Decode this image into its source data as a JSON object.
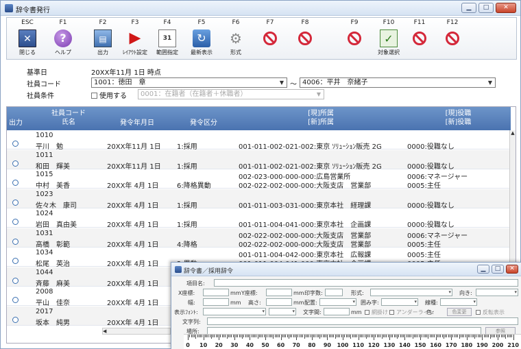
{
  "window": {
    "title": "辞令書発行"
  },
  "fkeys": [
    {
      "key": "ESC",
      "label": "閉じる",
      "icon": "close-icon"
    },
    {
      "key": "F1",
      "label": "ヘルプ",
      "icon": "help-icon"
    },
    {
      "key": "F2",
      "label": "出力",
      "icon": "output-icon"
    },
    {
      "key": "F3",
      "label": "ﾚｲｱｳﾄ設定",
      "icon": "play-icon"
    },
    {
      "key": "F4",
      "label": "範囲指定",
      "icon": "calendar-icon"
    },
    {
      "key": "F5",
      "label": "最新表示",
      "icon": "refresh-icon"
    },
    {
      "key": "F6",
      "label": "形式",
      "icon": "gear-icon"
    },
    {
      "key": "F7",
      "label": "",
      "icon": "disabled-icon"
    },
    {
      "key": "F8",
      "label": "",
      "icon": "disabled-icon"
    },
    {
      "key": "F9",
      "label": "",
      "icon": "disabled-icon"
    },
    {
      "key": "F10",
      "label": "対象選択",
      "icon": "check-icon"
    },
    {
      "key": "F11",
      "label": "",
      "icon": "disabled-icon"
    },
    {
      "key": "F12",
      "label": "",
      "icon": "disabled-icon"
    }
  ],
  "conditions": {
    "base_date_label": "基準日",
    "base_date_value": "20XX年11月 1日 時点",
    "emp_code_label": "社員コード",
    "emp_from": "1001：徳田　章",
    "tilde": "～",
    "emp_to": "4006：平井　奈緒子",
    "emp_cond_label": "社員条件",
    "use_label": "使用する",
    "cond_value": "0001：在籍者（在籍者＋休職者）"
  },
  "table": {
    "headers": {
      "out": "出力",
      "code": "社員コード",
      "name": "氏名",
      "issue_date": "発令年月日",
      "issue_type": "発令区分",
      "dept_cur": "[現]所属",
      "dept_new": "[新]所属",
      "pos_cur": "[現]役職",
      "pos_new": "[新]役職"
    },
    "rows": [
      {
        "code": "1010",
        "name": "平川　勉",
        "date": "20XX年11月 1日",
        "type": "1:採用",
        "dept1": "",
        "dept2": "001-011-002-021-002:東京 ｿﾘｭｰｼｮﾝ販売 2G",
        "pos1": "",
        "pos2": "0000:役職なし"
      },
      {
        "code": "1011",
        "name": "和田　輝美",
        "date": "20XX年11月 1日",
        "type": "1:採用",
        "dept1": "",
        "dept2": "001-011-002-021-002:東京 ｿﾘｭｰｼｮﾝ販売 2G",
        "pos1": "",
        "pos2": "0000:役職なし"
      },
      {
        "code": "1015",
        "name": "中村　美香",
        "date": "20XX年 4月 1日",
        "type": "6:降格異動",
        "dept1": "002-023-000-000-000:広島営業所",
        "dept2": "002-022-002-000-000:大阪支店　営業部",
        "pos1": "0006:マネージャー",
        "pos2": "0005:主任"
      },
      {
        "code": "1023",
        "name": "佐々木　康司",
        "date": "20XX年 4月 1日",
        "type": "1:採用",
        "dept1": "",
        "dept2": "001-011-003-031-000:東京本社　経理課",
        "pos1": "",
        "pos2": "0000:役職なし"
      },
      {
        "code": "1024",
        "name": "岩田　真由美",
        "date": "20XX年 4月 1日",
        "type": "1:採用",
        "dept1": "",
        "dept2": "001-011-004-041-000:東京本社　企画課",
        "pos1": "",
        "pos2": "0000:役職なし"
      },
      {
        "code": "1031",
        "name": "高橋　彰範",
        "date": "20XX年 4月 1日",
        "type": "4:降格",
        "dept1": "002-022-002-000-000:大阪支店　営業部",
        "dept2": "002-022-002-000-000:大阪支店　営業部",
        "pos1": "0006:マネージャー",
        "pos2": "0005:主任"
      },
      {
        "code": "1034",
        "name": "松尾　英治",
        "date": "20XX年 4月 1日",
        "type": "2:異動",
        "dept1": "001-011-004-042-000:東京本社　広報課",
        "dept2": "001-011-004-041-000:東京本社　企画課",
        "pos1": "0005:主任",
        "pos2": "0005:主任"
      },
      {
        "code": "1044",
        "name": "斉藤　麻美",
        "date": "20XX年 4月 1日",
        "type": "",
        "dept1": "",
        "dept2": "",
        "pos1": "",
        "pos2": ""
      },
      {
        "code": "2008",
        "name": "平山　佳奈",
        "date": "20XX年 4月 1日",
        "type": "",
        "dept1": "",
        "dept2": "",
        "pos1": "",
        "pos2": ""
      },
      {
        "code": "2017",
        "name": "坂本　純男",
        "date": "20XX年 4月 1日",
        "type": "",
        "dept1": "",
        "dept2": "",
        "pos1": "",
        "pos2": ""
      }
    ]
  },
  "subwin": {
    "title": "辞令書／採用辞令",
    "item_name": "項目名:",
    "x": "X座標:",
    "y": "Y座標:",
    "mm": "mm",
    "print_digits": "印字数:",
    "format": "形式:",
    "direction": "向き:",
    "width": "幅:",
    "height": "高さ:",
    "align": "配置:",
    "frame": "囲み字:",
    "line": "線種:",
    "font": "表示ﾌｫﾝﾄ:",
    "char_gap": "文字間:",
    "hyphen": "網掛け",
    "underline": "アンダーライン",
    "color": "色:",
    "color_change": "色変更",
    "reverse": "反転表示",
    "text": "文字列:",
    "place": "場所:",
    "ref": "参照",
    "ruler": [
      "0",
      "10",
      "20",
      "30",
      "40",
      "50",
      "60",
      "70",
      "80",
      "90",
      "100",
      "110",
      "120",
      "130",
      "140",
      "150",
      "160",
      "170",
      "180",
      "190",
      "200",
      "210"
    ]
  }
}
